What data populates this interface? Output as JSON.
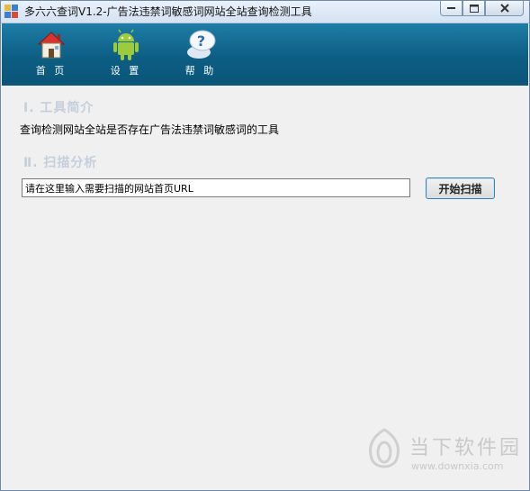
{
  "window": {
    "title": "多六六查词V1.2-广告法违禁词敏感词网站全站查询检测工具"
  },
  "toolbar": {
    "items": [
      {
        "label": "首 页",
        "icon": "house-icon"
      },
      {
        "label": "设 置",
        "icon": "android-icon"
      },
      {
        "label": "帮 助",
        "icon": "help-bubble-icon"
      }
    ]
  },
  "sections": {
    "intro_title": "Ⅰ. 工具简介",
    "intro_text": "查询检测网站全站是否存在广告法违禁词敏感词的工具",
    "scan_title": "Ⅱ. 扫描分析"
  },
  "scan": {
    "url_value": "请在这里输入需要扫描的网站首页URL",
    "start_button": "开始扫描"
  },
  "watermark": {
    "text": "当下软件园",
    "url": "www.downxia.com"
  },
  "colors": {
    "toolbar_top": "#1e7da6",
    "toolbar_bottom": "#0a5578",
    "section_title": "#c5cfdb"
  }
}
